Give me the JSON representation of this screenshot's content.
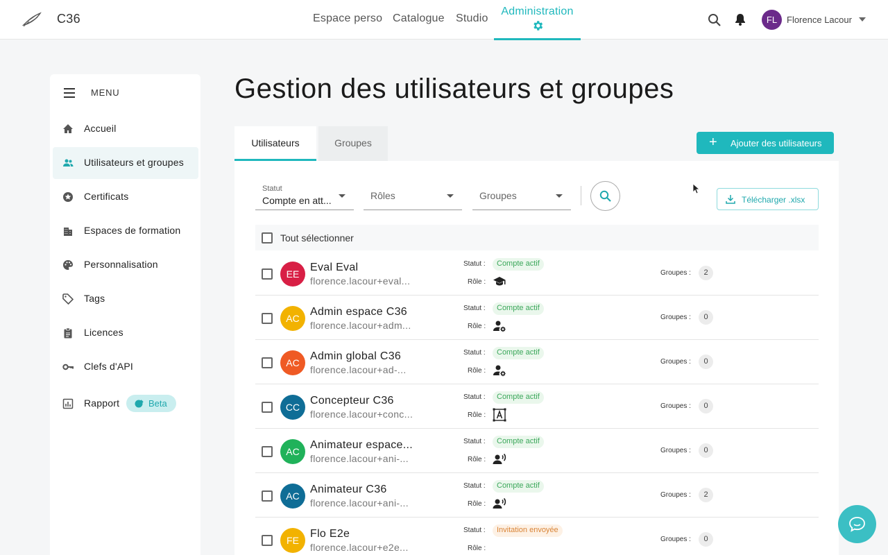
{
  "app": {
    "name": "C36"
  },
  "nav": {
    "items": [
      "Espace perso",
      "Catalogue",
      "Studio"
    ],
    "active": "Administration"
  },
  "user": {
    "initials": "FL",
    "name": "Florence Lacour"
  },
  "sidebar": {
    "menu_label": "MENU",
    "items": [
      {
        "label": "Accueil",
        "icon": "home-icon"
      },
      {
        "label": "Utilisateurs et groupes",
        "icon": "users-icon"
      },
      {
        "label": "Certificats",
        "icon": "certificate-icon"
      },
      {
        "label": "Espaces de formation",
        "icon": "building-icon"
      },
      {
        "label": "Personnalisation",
        "icon": "palette-icon"
      },
      {
        "label": "Tags",
        "icon": "tag-icon"
      },
      {
        "label": "Licences",
        "icon": "clipboard-icon"
      },
      {
        "label": "Clefs d'API",
        "icon": "key-icon"
      },
      {
        "label": "Rapport",
        "icon": "chart-icon"
      }
    ],
    "beta_label": "Beta"
  },
  "main": {
    "title": "Gestion des utilisateurs et groupes",
    "tabs": [
      "Utilisateurs",
      "Groupes"
    ],
    "add_button": "Ajouter des utilisateurs",
    "filters": {
      "status_label": "Statut",
      "status_value": "Compte en att...",
      "roles_placeholder": "Rôles",
      "groups_placeholder": "Groupes"
    },
    "download_button": "Télécharger .xlsx",
    "select_all": "Tout sélectionner",
    "labels": {
      "statut": "Statut :",
      "role": "Rôle :",
      "groupes": "Groupes :"
    }
  },
  "users": [
    {
      "initials": "EE",
      "name": "Eval Eval",
      "email": "florence.lacour+eval...",
      "status": "Compte actif",
      "role_icon": "graduation-cap-icon",
      "groups": "2",
      "color": "#d81f45"
    },
    {
      "initials": "AC",
      "name": "Admin espace C36",
      "email": "florence.lacour+adm...",
      "status": "Compte actif",
      "role_icon": "user-gear-icon",
      "groups": "0",
      "color": "#f2b200"
    },
    {
      "initials": "AC",
      "name": "Admin global C36",
      "email": "florence.lacour+ad-...",
      "status": "Compte actif",
      "role_icon": "user-gear-icon",
      "groups": "0",
      "color": "#ef5a24"
    },
    {
      "initials": "CC",
      "name": "Concepteur C36",
      "email": "florence.lacour+conc...",
      "status": "Compte actif",
      "role_icon": "design-icon",
      "groups": "0",
      "color": "#0f6d96"
    },
    {
      "initials": "AC",
      "name": "Animateur espace...",
      "email": "florence.lacour+ani-...",
      "status": "Compte actif",
      "role_icon": "speaker-user-icon",
      "groups": "0",
      "color": "#20b25a"
    },
    {
      "initials": "AC",
      "name": "Animateur C36",
      "email": "florence.lacour+ani-...",
      "status": "Compte actif",
      "role_icon": "speaker-user-icon",
      "groups": "2",
      "color": "#0f6d96"
    },
    {
      "initials": "FE",
      "name": "Flo E2e",
      "email": "florence.lacour+e2e...",
      "status": "Invitation envoyée",
      "role_icon": "",
      "groups": "0",
      "color": "#f2b200"
    }
  ]
}
